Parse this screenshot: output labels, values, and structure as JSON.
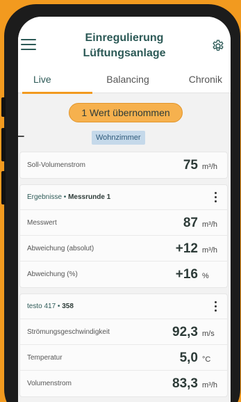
{
  "header": {
    "title_line1": "Einregulierung",
    "title_line2": "Lüftungsanlage"
  },
  "tabs": [
    {
      "label": "Live",
      "active": true
    },
    {
      "label": "Balancing",
      "active": false
    },
    {
      "label": "Chronik",
      "active": false
    }
  ],
  "notice": {
    "label": "1 Wert übernommen"
  },
  "context": {
    "room": "Wohnzimmer"
  },
  "setpoint": {
    "label": "Soll-Volumenstrom",
    "value": "75",
    "unit": "m³/h"
  },
  "results": {
    "header_prefix": "Ergebnisse",
    "header_sep": " • ",
    "header_round": "Messrunde 1",
    "rows": [
      {
        "label": "Messwert",
        "value": "87",
        "unit": "m³/h"
      },
      {
        "label": "Abweichung (absolut)",
        "value": "+12",
        "unit": "m³/h"
      },
      {
        "label": "Abweichung (%)",
        "value": "+16",
        "unit": "%"
      }
    ]
  },
  "device": {
    "header_prefix": "testo 417",
    "header_sep": " • ",
    "header_serial": "358",
    "rows": [
      {
        "label": "Strömungsgeschwindigkeit",
        "value": "92,3",
        "unit": "m/s"
      },
      {
        "label": "Temperatur",
        "value": "5,0",
        "unit": "°C"
      },
      {
        "label": "Volumenstrom",
        "value": "83,3",
        "unit": "m³/h"
      }
    ]
  },
  "colors": {
    "background": "#f29a1f",
    "accent": "#2d5a57",
    "pill": "#f6b14e",
    "room_badge": "#c5d9ea"
  },
  "icons": [
    "menu-icon",
    "gear-icon",
    "back-arrow-icon",
    "more-vert-icon"
  ]
}
